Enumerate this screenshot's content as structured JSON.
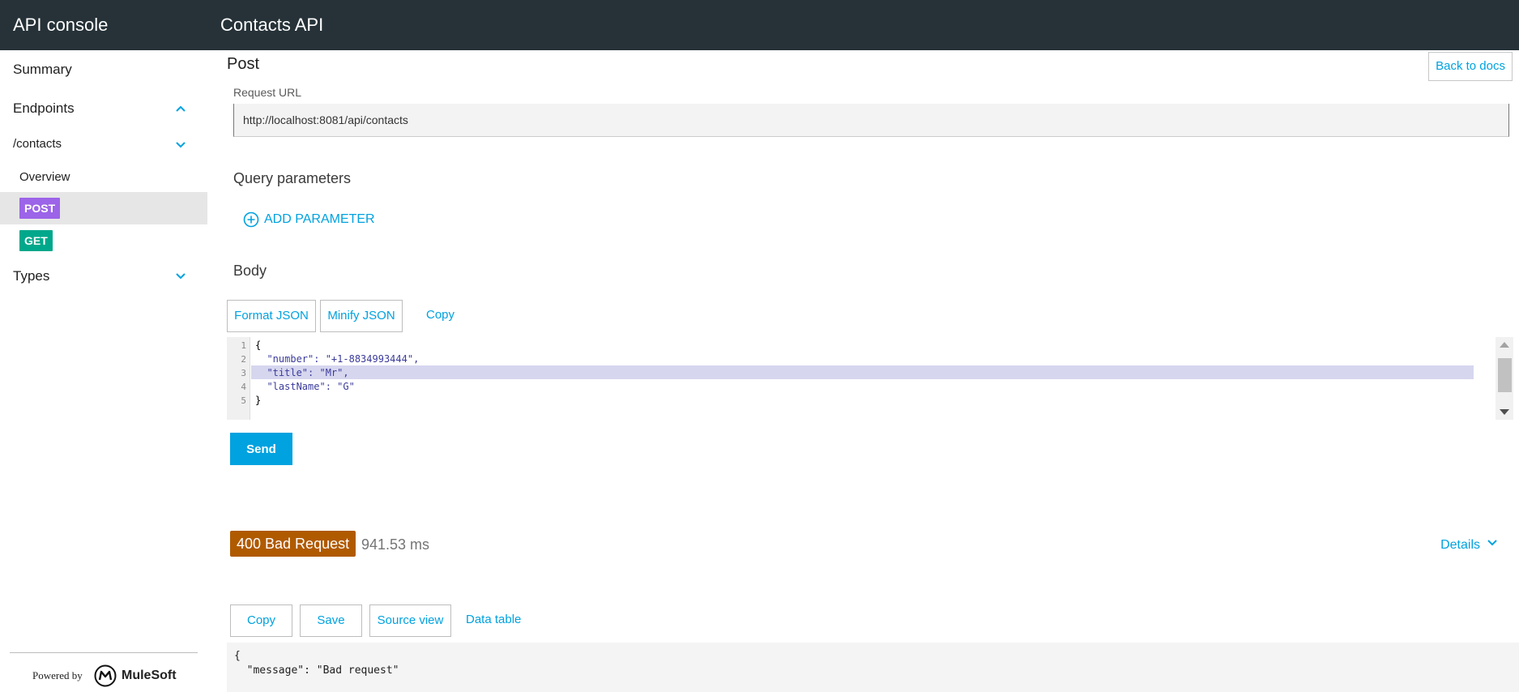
{
  "header": {
    "app_title": "API console",
    "api_title": "Contacts API"
  },
  "sidebar": {
    "summary": "Summary",
    "endpoints": "Endpoints",
    "resource": "/contacts",
    "overview": "Overview",
    "methods": [
      "POST",
      "GET"
    ],
    "types": "Types",
    "powered_by": "Powered by",
    "brand": "MuleSoft"
  },
  "request": {
    "method_title": "Post",
    "back_label": "Back to docs",
    "url_label": "Request URL",
    "url_value": "http://localhost:8081/api/contacts",
    "query_title": "Query parameters",
    "add_parameter": "ADD PARAMETER",
    "body_title": "Body",
    "format_json": "Format JSON",
    "minify_json": "Minify JSON",
    "copy": "Copy",
    "code_lines": [
      "{",
      "  \"number\": \"+1-8834993444\",",
      "  \"title\": \"Mr\",",
      "  \"lastName\": \"G\"",
      "}"
    ],
    "line_numbers": [
      "1",
      "2",
      "3",
      "4",
      "5"
    ],
    "send": "Send"
  },
  "response": {
    "status": "400 Bad Request",
    "duration": "941.53 ms",
    "details": "Details",
    "copy": "Copy",
    "save": "Save",
    "source_view": "Source view",
    "data_table": "Data table",
    "body_lines": [
      "{",
      "  \"message\": \"Bad request\""
    ]
  },
  "colors": {
    "topbar": "#263238",
    "accent": "#00a2df",
    "post": "#9c64e8",
    "get": "#00a88b",
    "status_error": "#b05a00"
  }
}
